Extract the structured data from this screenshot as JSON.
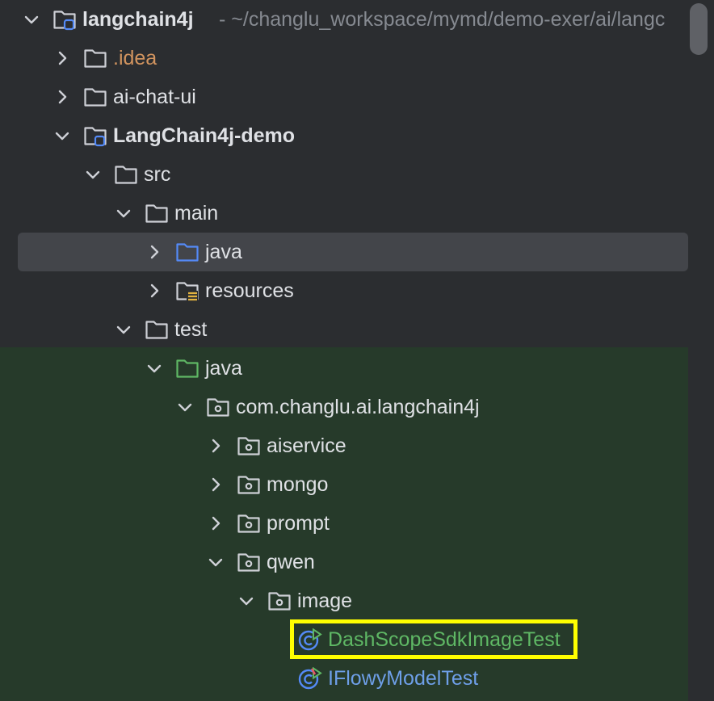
{
  "project_root": {
    "name": "langchain4j",
    "path": "- ~/changlu_workspace/mymd/demo-exer/ai/langc"
  },
  "nodes": [
    {
      "label": "langchain4j",
      "expanded": true,
      "icon": "module-folder-icon",
      "color": "#dfe1e5",
      "bold": true
    },
    {
      "label": ".idea",
      "expanded": false,
      "icon": "folder-icon",
      "color": "#d2945f"
    },
    {
      "label": "ai-chat-ui",
      "expanded": false,
      "icon": "folder-icon",
      "color": "#dfe1e5"
    },
    {
      "label": "LangChain4j-demo",
      "expanded": true,
      "icon": "module-folder-icon",
      "color": "#dfe1e5",
      "bold": true
    },
    {
      "label": "src",
      "expanded": true,
      "icon": "folder-icon",
      "color": "#dfe1e5"
    },
    {
      "label": "main",
      "expanded": true,
      "icon": "folder-icon",
      "color": "#dfe1e5"
    },
    {
      "label": "java",
      "expanded": false,
      "icon": "source-root-folder-icon",
      "color": "#dfe1e5",
      "selected": true
    },
    {
      "label": "resources",
      "expanded": false,
      "icon": "resources-folder-icon",
      "color": "#dfe1e5"
    },
    {
      "label": "test",
      "expanded": true,
      "icon": "folder-icon",
      "color": "#dfe1e5"
    },
    {
      "label": "java",
      "expanded": true,
      "icon": "test-root-folder-icon",
      "color": "#dfe1e5"
    },
    {
      "label": "com.changlu.ai.langchain4j",
      "expanded": true,
      "icon": "package-icon",
      "color": "#dfe1e5"
    },
    {
      "label": "aiservice",
      "expanded": false,
      "icon": "package-icon",
      "color": "#dfe1e5"
    },
    {
      "label": "mongo",
      "expanded": false,
      "icon": "package-icon",
      "color": "#dfe1e5"
    },
    {
      "label": "prompt",
      "expanded": false,
      "icon": "package-icon",
      "color": "#dfe1e5"
    },
    {
      "label": "qwen",
      "expanded": true,
      "icon": "package-icon",
      "color": "#dfe1e5"
    },
    {
      "label": "image",
      "expanded": true,
      "icon": "package-icon",
      "color": "#dfe1e5"
    },
    {
      "label": "DashScopeSdkImageTest",
      "icon": "test-class-run-icon",
      "color": "#5fb865",
      "highlighted": true
    },
    {
      "label": "IFlowyModelTest",
      "icon": "test-class-error-icon",
      "color": "#6e9fe8"
    }
  ],
  "colors": {
    "background": "#2b2d30",
    "test_background": "#263a2a",
    "selection": "#43454a",
    "highlight_border": "#ffff00"
  }
}
